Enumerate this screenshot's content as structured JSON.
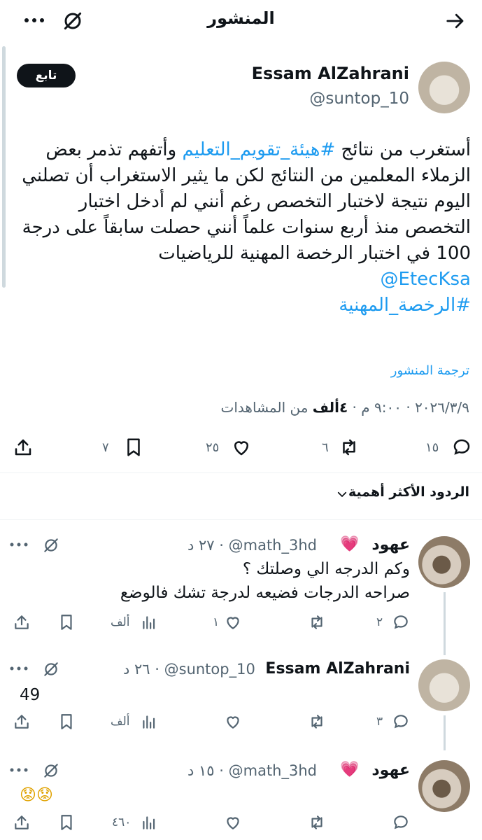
{
  "header": {
    "title": "المنشور"
  },
  "post": {
    "author_name": "Essam AlZahrani",
    "handle": "@suntop_10",
    "follow_label": "تابع",
    "body": {
      "p1_text": "أستغرب من نتائج ",
      "p1_hashtag": "#هيئة_تقويم_التعليم",
      "p1_rest": " وأتفهم تذمر بعض",
      "line2": "الزملاء المعلمين من النتائج لكن ما يثير الاستغراب أن تصلني",
      "line3": "اليوم نتيجة لاختبار التخصص رغم أنني لم أدخل اختبار",
      "line4": "التخصص منذ أربع سنوات علماً أنني حصلت سابقاً على درجة",
      "line5": "100 في اختبار الرخصة المهنية للرياضيات",
      "mention": "@EtecKsa",
      "hashtag2": "#الرخصة_المهنية"
    },
    "translate_label": "ترجمة المنشور",
    "meta": {
      "date": "٢٠٢٦/٣/٩",
      "time": "٩:٠٠ م",
      "views_count": "٤ألف",
      "views_label": "من المشاهدات",
      "separator": "·"
    },
    "actions": {
      "replies": "١٥",
      "reposts": "٦",
      "likes": "٢٥",
      "bookmarks": "٧"
    }
  },
  "sort": {
    "label": "الردود الأكثر أهمية"
  },
  "replies": [
    {
      "name": "عهود",
      "handle": "@math_3hd",
      "time": "٢٧ د",
      "lines": [
        "وكم الدرجه الي وصلتك ؟",
        "صراحه الدرجات فضيعه لدرجة تشك فالوضع"
      ],
      "counts": {
        "replies": "٢",
        "reposts": "",
        "likes": "١",
        "views": "ألف"
      }
    },
    {
      "name": "Essam AlZahrani",
      "handle": "@suntop_10",
      "time": "٢٦ د",
      "lines": [
        "49"
      ],
      "counts": {
        "replies": "٣",
        "reposts": "",
        "likes": "",
        "views": "ألف"
      }
    },
    {
      "name": "عهود",
      "handle": "@math_3hd",
      "time": "١٥ د",
      "lines": [
        "😟😟"
      ],
      "counts": {
        "replies": "",
        "reposts": "",
        "likes": "",
        "views": "٤٦٠"
      }
    }
  ],
  "colors": {
    "accent": "#1d9bf0",
    "text": "#0f1419",
    "muted": "#536471",
    "divider": "#eff3f4"
  }
}
